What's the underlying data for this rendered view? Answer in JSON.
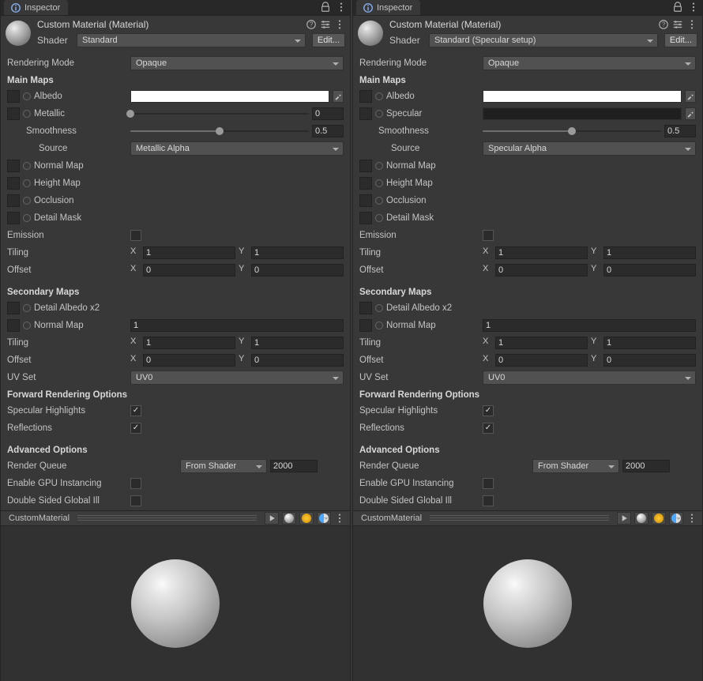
{
  "panels": {
    "left": {
      "tab": "Inspector",
      "material_name": "Custom Material (Material)",
      "shader_label": "Shader",
      "shader_value": "Standard",
      "edit_btn": "Edit...",
      "rendering_mode_label": "Rendering Mode",
      "rendering_mode_value": "Opaque",
      "section_main_maps": "Main Maps",
      "albedo_label": "Albedo",
      "workflow_label": "Metallic",
      "workflow_slider_value": "0",
      "workflow_is_slider": true,
      "smoothness_label": "Smoothness",
      "smoothness_value": "0.5",
      "source_label": "Source",
      "source_value": "Metallic Alpha",
      "normal_label": "Normal Map",
      "height_label": "Height Map",
      "occlusion_label": "Occlusion",
      "detailmask_label": "Detail Mask",
      "emission_label": "Emission",
      "tiling_label": "Tiling",
      "tiling_x": "1",
      "tiling_y": "1",
      "offset_label": "Offset",
      "offset_x": "0",
      "offset_y": "0",
      "section_secondary": "Secondary Maps",
      "detail_albedo_label": "Detail Albedo x2",
      "sec_normal_label": "Normal Map",
      "sec_normal_value": "1",
      "sec_tiling_label": "Tiling",
      "sec_tiling_x": "1",
      "sec_tiling_y": "1",
      "sec_offset_label": "Offset",
      "sec_offset_x": "0",
      "sec_offset_y": "0",
      "uv_set_label": "UV Set",
      "uv_set_value": "UV0",
      "section_forward": "Forward Rendering Options",
      "spec_highlights_label": "Specular Highlights",
      "spec_highlights": true,
      "reflections_label": "Reflections",
      "reflections": true,
      "section_advanced": "Advanced Options",
      "render_queue_label": "Render Queue",
      "render_queue_mode": "From Shader",
      "render_queue_value": "2000",
      "gpu_inst_label": "Enable GPU Instancing",
      "gpu_inst": false,
      "dsgi_label": "Double Sided Global Ill",
      "dsgi": false,
      "asset_name": "CustomMaterial"
    },
    "right": {
      "tab": "Inspector",
      "material_name": "Custom Material (Material)",
      "shader_label": "Shader",
      "shader_value": "Standard (Specular setup)",
      "edit_btn": "Edit...",
      "rendering_mode_label": "Rendering Mode",
      "rendering_mode_value": "Opaque",
      "section_main_maps": "Main Maps",
      "albedo_label": "Albedo",
      "workflow_label": "Specular",
      "workflow_is_slider": false,
      "smoothness_label": "Smoothness",
      "smoothness_value": "0.5",
      "source_label": "Source",
      "source_value": "Specular Alpha",
      "normal_label": "Normal Map",
      "height_label": "Height Map",
      "occlusion_label": "Occlusion",
      "detailmask_label": "Detail Mask",
      "emission_label": "Emission",
      "tiling_label": "Tiling",
      "tiling_x": "1",
      "tiling_y": "1",
      "offset_label": "Offset",
      "offset_x": "0",
      "offset_y": "0",
      "section_secondary": "Secondary Maps",
      "detail_albedo_label": "Detail Albedo x2",
      "sec_normal_label": "Normal Map",
      "sec_normal_value": "1",
      "sec_tiling_label": "Tiling",
      "sec_tiling_x": "1",
      "sec_tiling_y": "1",
      "sec_offset_label": "Offset",
      "sec_offset_x": "0",
      "sec_offset_y": "0",
      "uv_set_label": "UV Set",
      "uv_set_value": "UV0",
      "section_forward": "Forward Rendering Options",
      "spec_highlights_label": "Specular Highlights",
      "spec_highlights": true,
      "reflections_label": "Reflections",
      "reflections": true,
      "section_advanced": "Advanced Options",
      "render_queue_label": "Render Queue",
      "render_queue_mode": "From Shader",
      "render_queue_value": "2000",
      "gpu_inst_label": "Enable GPU Instancing",
      "gpu_inst": false,
      "dsgi_label": "Double Sided Global Ill",
      "dsgi": false,
      "asset_name": "CustomMaterial"
    }
  },
  "x_label": "X",
  "y_label": "Y"
}
